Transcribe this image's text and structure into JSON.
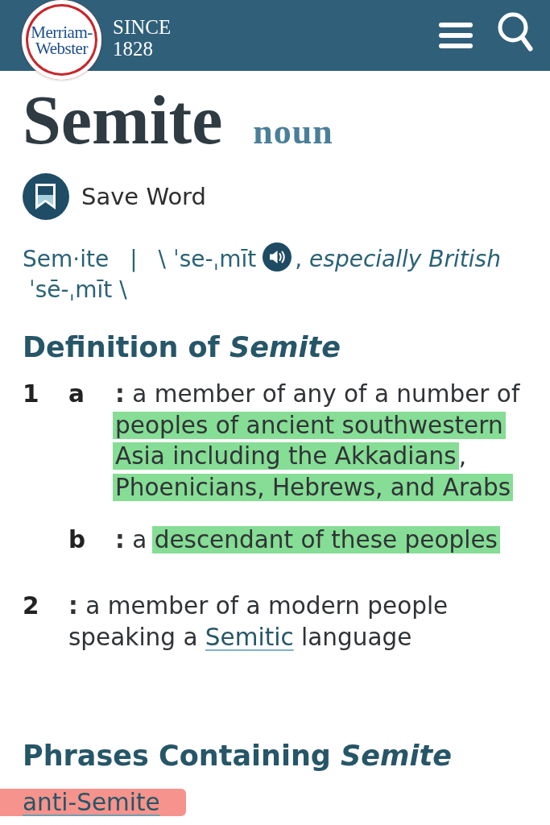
{
  "header": {
    "logo_lines": [
      "Merriam-",
      "Webster"
    ],
    "tagline_lines": [
      "SINCE",
      "1828"
    ]
  },
  "entry": {
    "headword": "Semite",
    "part_of_speech": "noun",
    "save_label": "Save Word"
  },
  "pronunciation": {
    "syllables": "Sem·ite",
    "separator": "|",
    "primary": "\\ ˈse-ˌmīt",
    "variant_label": ", *especially British*",
    "variant": "ˈsē-ˌmīt \\"
  },
  "definition_heading": "Definition of *Semite*",
  "definitions": [
    {
      "number": "1",
      "subsenses": [
        {
          "letter": "a",
          "lines": [
            {
              "runs": [
                {
                  "text": "**:** a member of any of a number of",
                  "kind": "text",
                  "highlighted": false
                }
              ]
            },
            {
              "runs": [
                {
                  "text": "peoples of ancient southwestern",
                  "kind": "text",
                  "highlighted": true,
                  "color": "#86dd95"
                }
              ]
            },
            {
              "runs": [
                {
                  "text": "Asia including the Akkadians",
                  "kind": "text",
                  "highlighted": true,
                  "color": "#86dd95"
                },
                {
                  "text": ",",
                  "kind": "text",
                  "highlighted": false
                }
              ]
            },
            {
              "runs": [
                {
                  "text": "Phoenicians, Hebrews, and Arabs",
                  "kind": "text",
                  "highlighted": true,
                  "color": "#86dd95"
                }
              ]
            }
          ]
        },
        {
          "letter": "b",
          "lines": [
            {
              "runs": [
                {
                  "text": "**:** a ",
                  "kind": "text",
                  "highlighted": false
                },
                {
                  "text": "descendant of these peoples",
                  "kind": "text",
                  "highlighted": true,
                  "color": "#86dd95"
                }
              ]
            }
          ]
        }
      ]
    },
    {
      "number": "2",
      "subsenses": [
        {
          "lines": [
            {
              "runs": [
                {
                  "text": "**:** a member of a modern people",
                  "kind": "text",
                  "highlighted": false
                }
              ]
            },
            {
              "runs": [
                {
                  "text": "speaking a ",
                  "kind": "text",
                  "highlighted": false
                },
                {
                  "text": "Semitic",
                  "kind": "link",
                  "highlighted": false
                },
                {
                  "text": " language",
                  "kind": "text",
                  "highlighted": false
                }
              ]
            }
          ]
        }
      ]
    }
  ],
  "phrases_heading": "Phrases Containing *Semite*",
  "phrases": [
    {
      "text": "anti-Semite",
      "highlighted": true,
      "color": "#f5938c"
    }
  ]
}
